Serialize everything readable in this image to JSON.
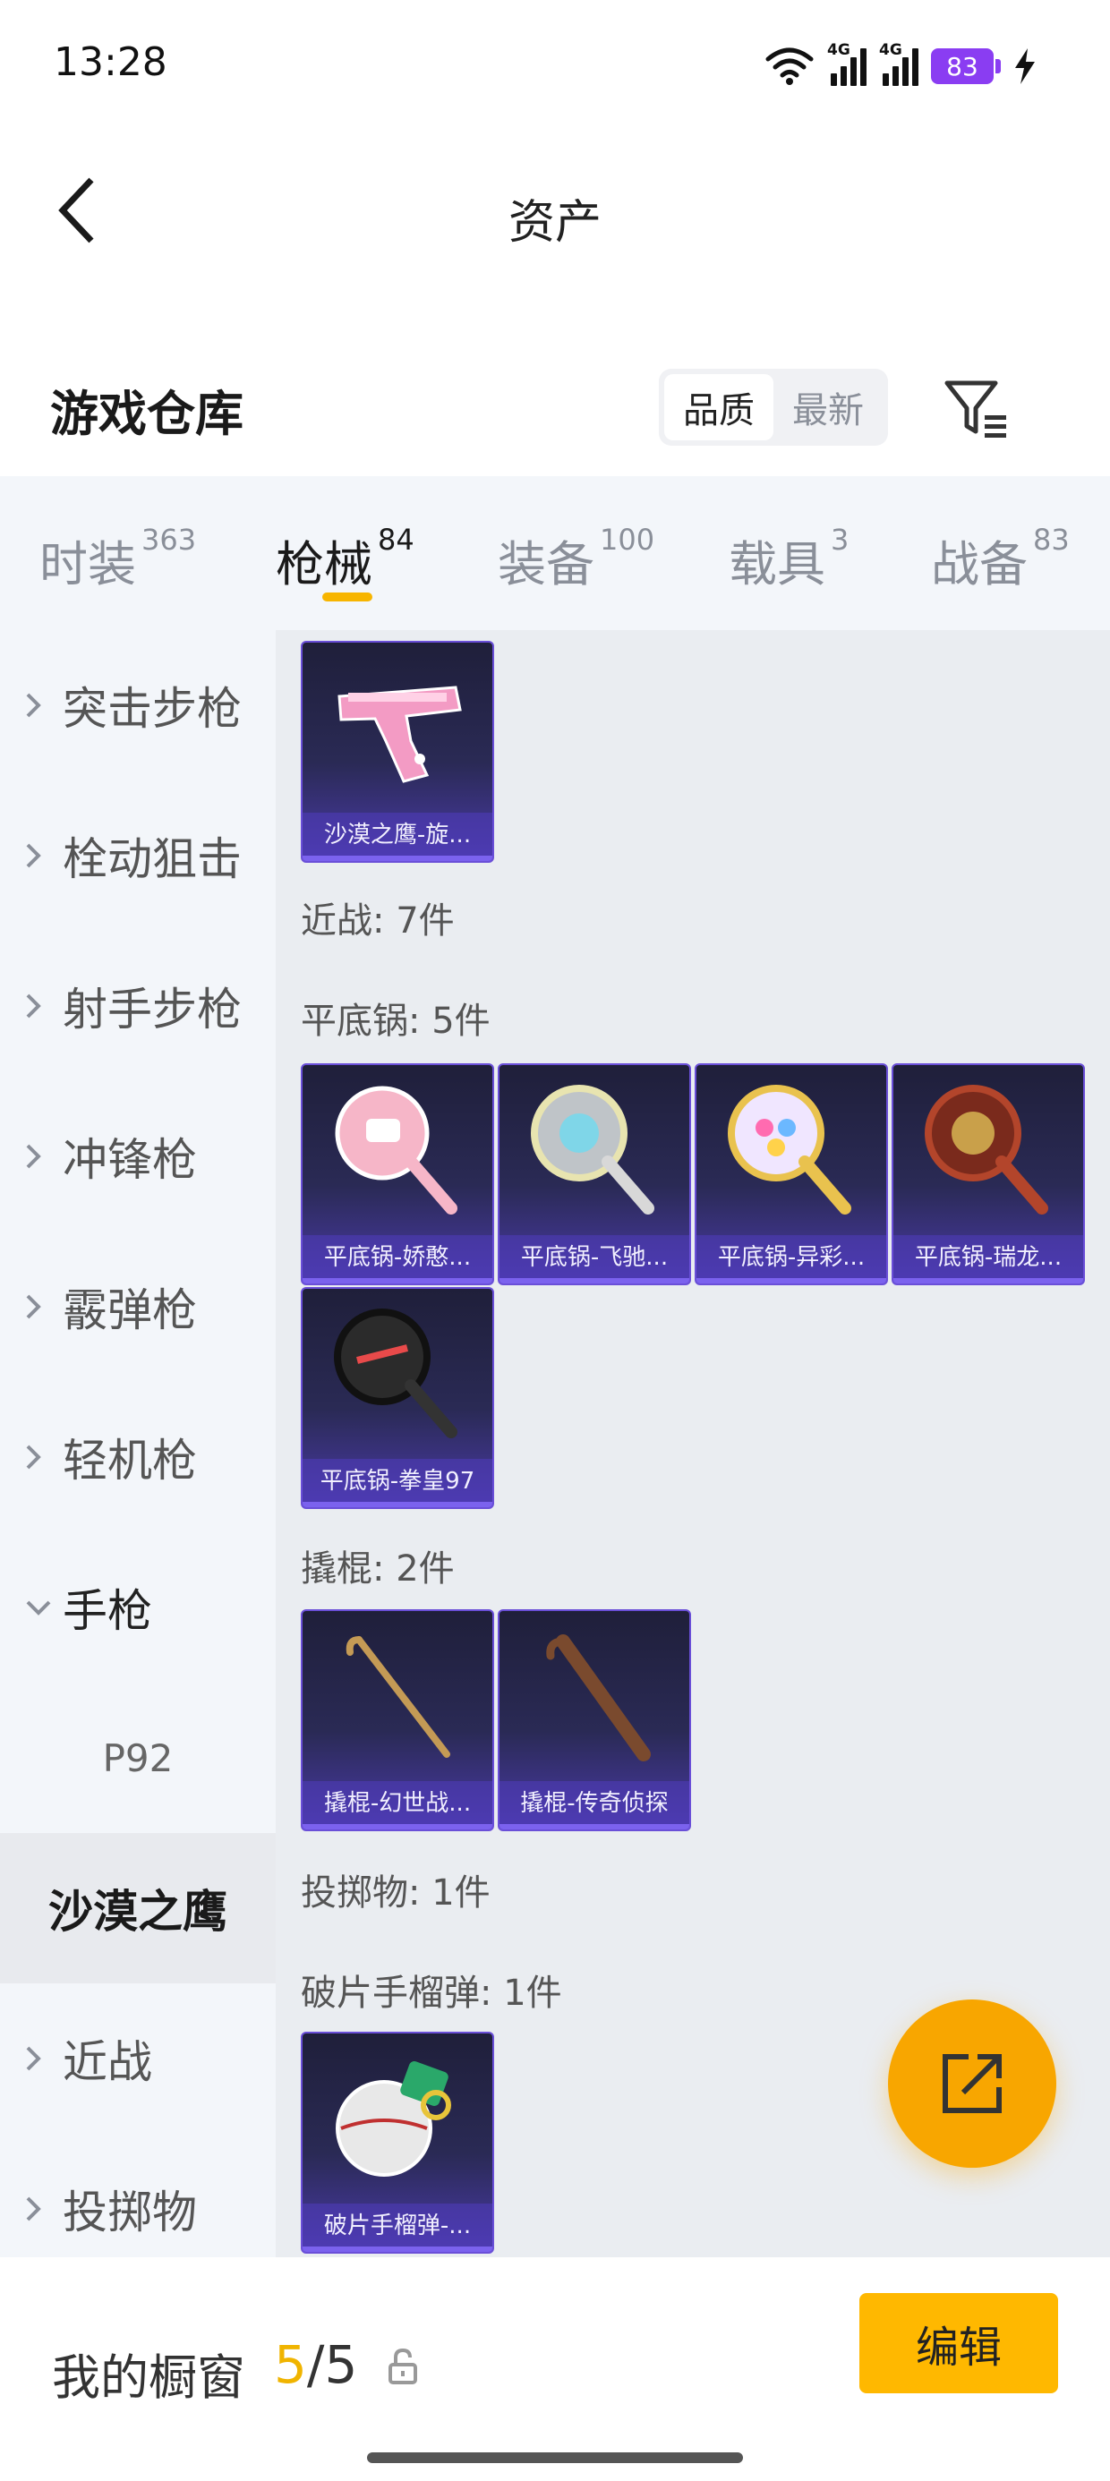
{
  "status_bar": {
    "time": "13:28",
    "network_1": "4G",
    "network_2": "4G",
    "battery": "83",
    "icons": [
      "wifi-icon",
      "signal-icon",
      "signal-icon",
      "battery-icon",
      "charging-icon"
    ]
  },
  "header": {
    "title": "资产",
    "back_icon": "chevron-left-icon"
  },
  "warehouse": {
    "title": "游戏仓库",
    "sort_options": [
      "品质",
      "最新"
    ],
    "sort_selected": "品质",
    "filter_icon": "filter-icon"
  },
  "tabs": [
    {
      "label": "时装",
      "count": "363",
      "active": false
    },
    {
      "label": "枪械",
      "count": "84",
      "active": true
    },
    {
      "label": "装备",
      "count": "100",
      "active": false
    },
    {
      "label": "载具",
      "count": "3",
      "active": false
    },
    {
      "label": "战备",
      "count": "83",
      "active": false
    }
  ],
  "sidebar": {
    "items": [
      {
        "label": "突击步枪",
        "expanded": false
      },
      {
        "label": "栓动狙击",
        "expanded": false
      },
      {
        "label": "射手步枪",
        "expanded": false
      },
      {
        "label": "冲锋枪",
        "expanded": false
      },
      {
        "label": "霰弹枪",
        "expanded": false
      },
      {
        "label": "轻机枪",
        "expanded": false
      },
      {
        "label": "手枪",
        "expanded": true
      },
      {
        "label": "近战",
        "expanded": false
      },
      {
        "label": "投掷物",
        "expanded": false
      }
    ],
    "subitems": [
      {
        "label": "P92",
        "selected": false
      },
      {
        "label": "沙漠之鹰",
        "selected": true
      }
    ]
  },
  "content": {
    "top_items": [
      {
        "label": "沙漠之鹰-旋...",
        "icon": "pistol-icon",
        "accent": "#f39bc4"
      }
    ],
    "groups": [
      {
        "title": "近战: 7件",
        "items": []
      },
      {
        "title": "平底锅: 5件",
        "items": [
          {
            "label": "平底锅-娇憨...",
            "icon": "pan-icon",
            "accent": "#f6b6c8"
          },
          {
            "label": "平底锅-飞驰...",
            "icon": "pan-icon",
            "accent": "#e8e4b0"
          },
          {
            "label": "平底锅-异彩...",
            "icon": "pan-icon",
            "accent": "#e9c24e"
          },
          {
            "label": "平底锅-瑞龙...",
            "icon": "pan-icon",
            "accent": "#b3452b"
          },
          {
            "label": "平底锅-拳皇97",
            "icon": "pan-icon",
            "accent": "#2b2b2b"
          }
        ]
      },
      {
        "title": "撬棍: 2件",
        "items": [
          {
            "label": "撬棍-幻世战...",
            "icon": "crowbar-icon",
            "accent": "#c49a55"
          },
          {
            "label": "撬棍-传奇侦探",
            "icon": "umbrella-icon",
            "accent": "#7a4a2e"
          }
        ]
      },
      {
        "title": "投掷物: 1件",
        "items": []
      },
      {
        "title": "破片手榴弹: 1件",
        "items": [
          {
            "label": "破片手榴弹-...",
            "icon": "grenade-icon",
            "accent": "#e8e8e8"
          }
        ]
      }
    ]
  },
  "fab": {
    "icon": "share-icon",
    "color": "#f8a600"
  },
  "bottom_bar": {
    "showcase_label": "我的橱窗",
    "showcase_current": "5",
    "showcase_separator": "/",
    "showcase_total": "5",
    "lock_icon": "lock-icon",
    "edit_label": "编辑",
    "accent": "#ffb800"
  }
}
